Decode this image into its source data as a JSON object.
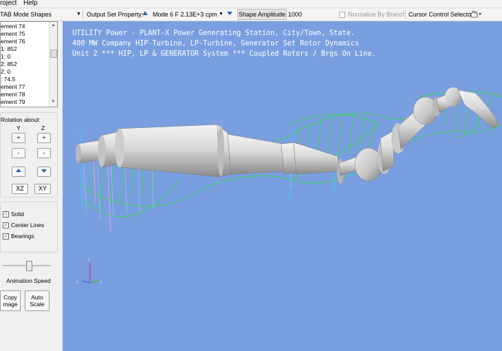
{
  "menu": {
    "project": "roject",
    "help": "Help"
  },
  "toolbar": {
    "mode_shapes": "TAB Mode Shapes",
    "output_set_label": "Output Set Property:",
    "mode_value": "Mode 6  F 2.13E+3 cpm",
    "shape_amplitude_label": "Shape Amplitude",
    "shape_amplitude_value": "1000",
    "normalize_label": "Normalize By Branch",
    "cursor_label": "Cursor Control Selector"
  },
  "list": {
    "rows": [
      "ement 74",
      "ement 75",
      "ement 76",
      "1:   852",
      "1:   0",
      "2:   852",
      "2:   0",
      ":    74.5",
      "ement 77",
      "ement 78",
      "ement 79"
    ]
  },
  "rotation": {
    "label": "Rotation about:",
    "y": "Y",
    "z": "Z",
    "plus": "+",
    "minus": "-",
    "xz": "XZ",
    "xy": "XY"
  },
  "options": {
    "solid": "Solid",
    "center_lines": "Center Lines",
    "bearings": "Bearings"
  },
  "animation": {
    "label": "Animation Speed",
    "level": 0.55
  },
  "buttons": {
    "copy_1": "Copy",
    "copy_2": "mage",
    "auto_1": "Auto",
    "auto_2": "Scale"
  },
  "viewport": {
    "line1": "UTILITY Power - PLANT-X Power Generating Station, City/Town, State.",
    "line2": "400 MW Company HIP-Turbine, LP-Turbine, Generator Set Rotor Dynamics",
    "line3": "Unit 2 *** HIP, LP & GENERATOR System *** Coupled Rotors / Brgs On Line."
  },
  "colors": {
    "background": "#7a9fe0",
    "mode_shape": "#22ee22",
    "rotor": "#c8c8c8"
  }
}
